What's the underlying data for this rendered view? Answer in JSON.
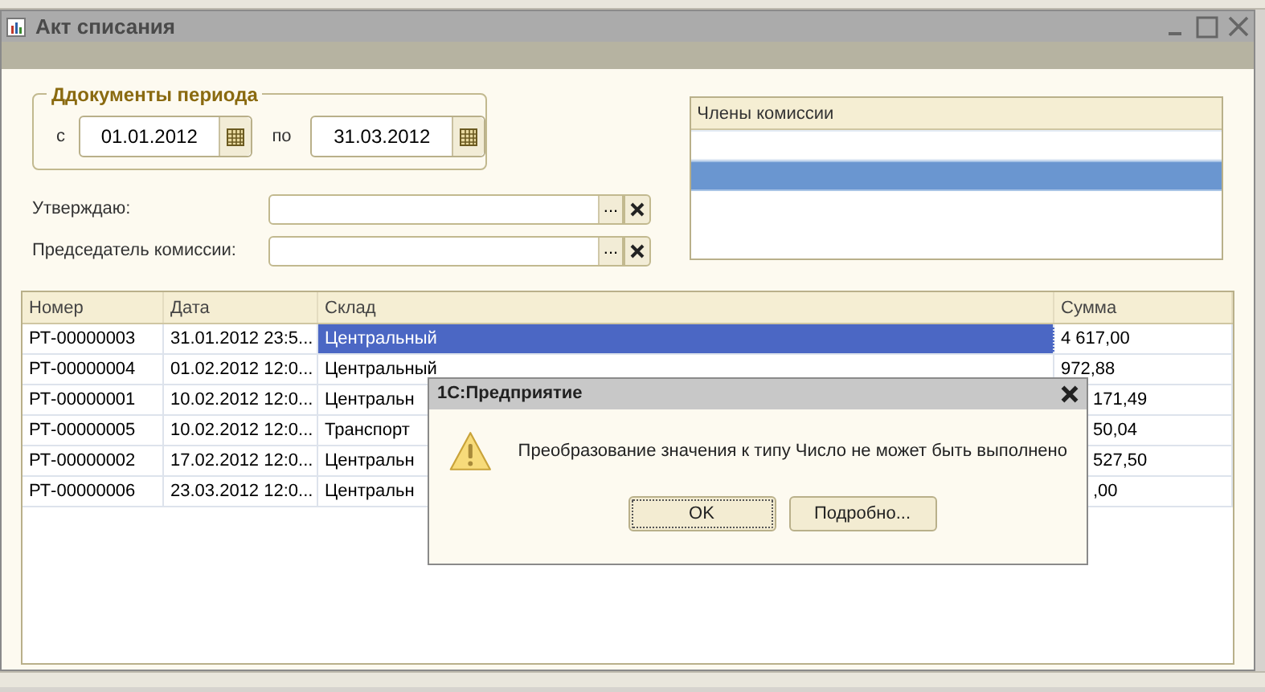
{
  "window": {
    "title": "Акт списания"
  },
  "period": {
    "title": "Ддокументы периода",
    "from_label": "с",
    "from": "01.01.2012",
    "to_label": "по",
    "to": "31.03.2012"
  },
  "fields": [
    {
      "label": "Утверждаю:",
      "choose": "..."
    },
    {
      "label": "Председатель комиссии:",
      "choose": "..."
    }
  ],
  "members": {
    "header": "Члены комиссии",
    "rows": [
      {
        "selected": false
      },
      {
        "selected": true
      }
    ]
  },
  "table": {
    "columns": [
      "Номер",
      "Дата",
      "Склад",
      "Сумма"
    ],
    "rows": [
      {
        "selected": true,
        "cells": [
          "РТ-00000003",
          "31.01.2012 23:5...",
          "Центральный",
          "4 617,00"
        ]
      },
      {
        "selected": false,
        "cells": [
          "РТ-00000004",
          "01.02.2012 12:0...",
          "Центральный",
          "972,88"
        ]
      },
      {
        "selected": false,
        "cells": [
          "РТ-00000001",
          "10.02.2012 12:0...",
          "Центральн",
          "171,49"
        ]
      },
      {
        "selected": false,
        "cells": [
          "РТ-00000005",
          "10.02.2012 12:0...",
          "Транспорт",
          "50,04"
        ]
      },
      {
        "selected": false,
        "cells": [
          "РТ-00000002",
          "17.02.2012 12:0...",
          "Центральн",
          "527,50"
        ]
      },
      {
        "selected": false,
        "cells": [
          "РТ-00000006",
          "23.03.2012 12:0...",
          "Центральн",
          ",00"
        ]
      }
    ]
  },
  "dialog": {
    "title": "1С:Предприятие",
    "message": "Преобразование значения к типу Число не может быть выполнено",
    "buttons": [
      {
        "label": "OK",
        "default": true
      },
      {
        "label": "Подробно...",
        "default": false
      }
    ]
  }
}
